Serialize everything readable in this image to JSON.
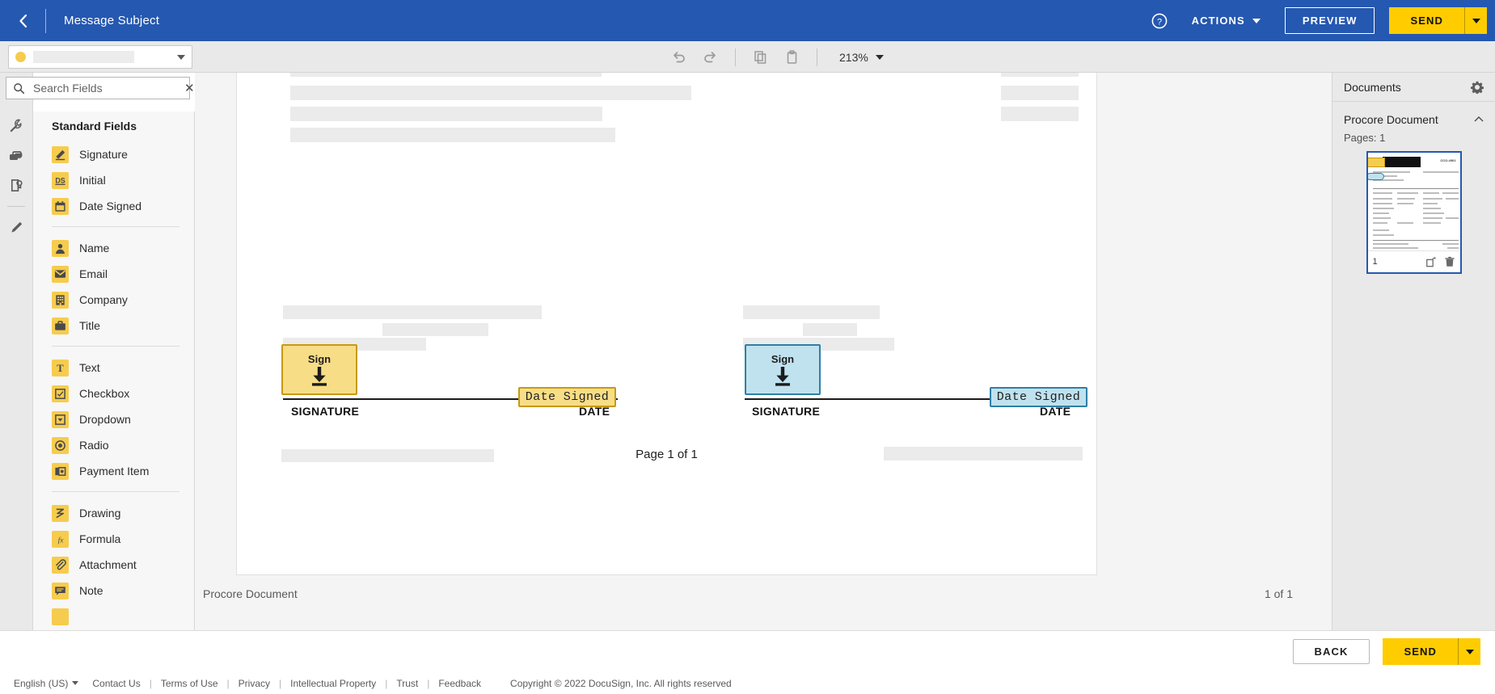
{
  "topbar": {
    "back_icon": "chevron-left-icon",
    "message_subject": "Message Subject",
    "help_icon": "help-circle-icon",
    "actions_label": "ACTIONS",
    "preview_label": "PREVIEW",
    "send_label": "SEND",
    "brand_blue": "#2558b0",
    "brand_yellow": "#ffcc00"
  },
  "toolbar": {
    "recipient_placeholder": "",
    "recipient_dot_color": "#f6cc4e",
    "undo_icon": "undo-icon",
    "redo_icon": "redo-icon",
    "copy_icon": "copy-icon",
    "paste_icon": "paste-icon",
    "zoom_level": "213%"
  },
  "rail": {
    "items": [
      {
        "name": "custom-fields-icon"
      },
      {
        "name": "merge-fields-icon"
      },
      {
        "name": "seal-certificate-icon"
      },
      {
        "name": "annotate-pencil-icon"
      }
    ]
  },
  "search": {
    "icon": "search-icon",
    "placeholder": "Search Fields",
    "value": "",
    "clear_icon": "close-icon"
  },
  "fields_panel": {
    "title": "Standard Fields",
    "groups": [
      {
        "items": [
          {
            "label": "Signature",
            "icon": "signature-icon"
          },
          {
            "label": "Initial",
            "icon": "initial-ds-icon"
          },
          {
            "label": "Date Signed",
            "icon": "calendar-icon"
          }
        ]
      },
      {
        "items": [
          {
            "label": "Name",
            "icon": "person-icon"
          },
          {
            "label": "Email",
            "icon": "envelope-icon"
          },
          {
            "label": "Company",
            "icon": "building-icon"
          },
          {
            "label": "Title",
            "icon": "briefcase-icon"
          }
        ]
      },
      {
        "items": [
          {
            "label": "Text",
            "icon": "text-t-icon"
          },
          {
            "label": "Checkbox",
            "icon": "checkbox-icon"
          },
          {
            "label": "Dropdown",
            "icon": "dropdown-icon"
          },
          {
            "label": "Radio",
            "icon": "radio-icon"
          },
          {
            "label": "Payment Item",
            "icon": "payment-icon"
          }
        ]
      },
      {
        "items": [
          {
            "label": "Drawing",
            "icon": "drawing-icon"
          },
          {
            "label": "Formula",
            "icon": "formula-fx-icon"
          },
          {
            "label": "Attachment",
            "icon": "paperclip-icon"
          },
          {
            "label": "Note",
            "icon": "note-icon"
          }
        ]
      }
    ]
  },
  "document": {
    "page_label": "Page 1 of 1",
    "footer_name": "Procore Document",
    "footer_count": "1 of 1",
    "tags": [
      {
        "type": "signature",
        "label": "Sign",
        "color": "yellow",
        "recipient": 1
      },
      {
        "type": "date_signed",
        "label": "Date Signed",
        "color": "yellow",
        "recipient": 1
      },
      {
        "type": "signature",
        "label": "Sign",
        "color": "blue",
        "recipient": 2
      },
      {
        "type": "date_signed",
        "label": "Date Signed",
        "color": "blue",
        "recipient": 2
      }
    ],
    "signature_label_left": "SIGNATURE",
    "date_label_left": "DATE",
    "signature_label_right": "SIGNATURE",
    "date_label_right": "DATE"
  },
  "right_panel": {
    "title": "Documents",
    "gear_icon": "gear-icon",
    "document_name": "Procore Document",
    "collapse_icon": "chevron-up-icon",
    "pages_label": "Pages: 1",
    "thumbnail": {
      "page_number": "1",
      "rotate_icon": "rotate-icon",
      "delete_icon": "trash-icon",
      "header_code": "CCO-#001"
    }
  },
  "bottombar": {
    "back_label": "BACK",
    "send_label": "SEND"
  },
  "footer": {
    "language": "English (US)",
    "links": [
      "Contact Us",
      "Terms of Use",
      "Privacy",
      "Intellectual Property",
      "Trust",
      "Feedback"
    ],
    "copyright": "Copyright © 2022 DocuSign, Inc. All rights reserved"
  }
}
